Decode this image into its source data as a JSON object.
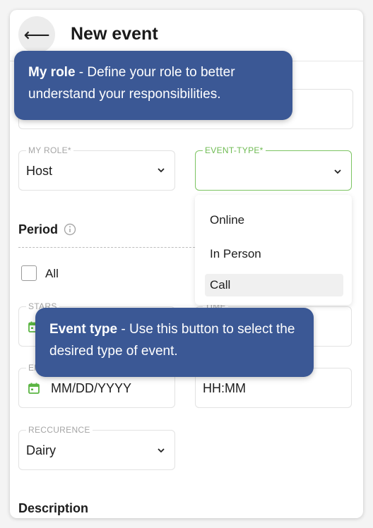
{
  "header": {
    "back_icon": "arrow-left-icon",
    "title": "New event"
  },
  "tooltips": [
    {
      "bold": "My role",
      "text": " - Define your role to better understand your responsibilities."
    },
    {
      "bold": "Event type",
      "text": " - Use this button to select the desired type of event."
    }
  ],
  "my_role": {
    "label": "MY ROLE*",
    "value": "Host"
  },
  "event_type": {
    "label": "EVENT-TYPE*",
    "value": "",
    "options": [
      "Online",
      "In Person",
      "Call"
    ],
    "selected": "Call"
  },
  "period": {
    "title": "Period",
    "all_label": "All",
    "all_checked": false
  },
  "start": {
    "label": "STARS",
    "time_label": "TIME"
  },
  "end": {
    "label": "END",
    "date_placeholder": "MM/DD/YYYY",
    "time_placeholder": "HH:MM"
  },
  "recurrence": {
    "label": "RECCURENCE",
    "value": "Dairy"
  },
  "description": {
    "title": "Description"
  },
  "colors": {
    "accent_green": "#7cc462",
    "tooltip_bg": "#3b5895"
  }
}
